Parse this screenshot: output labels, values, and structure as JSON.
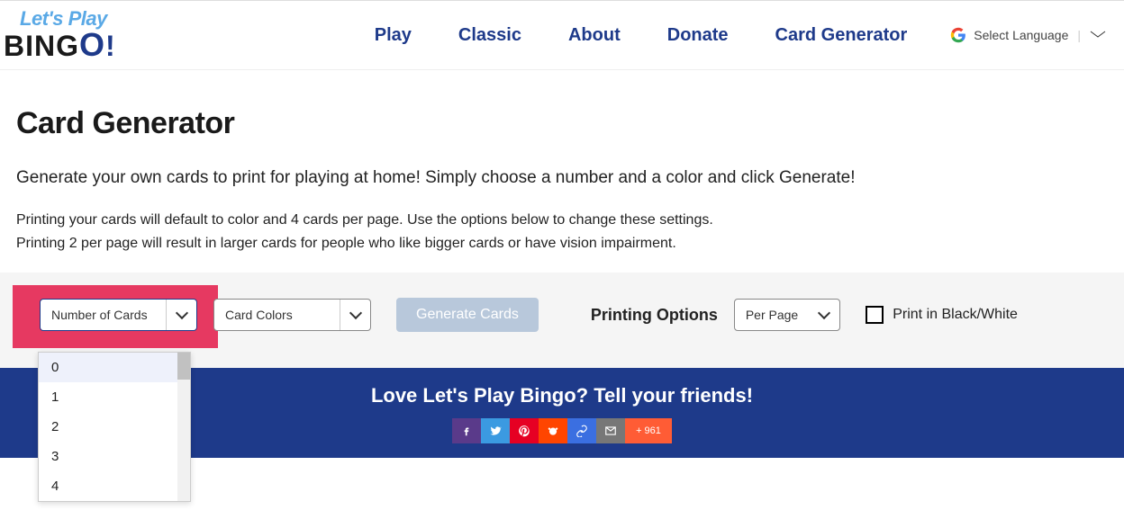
{
  "logo": {
    "top": "Let's Play",
    "bottom": "BING",
    "o": "O",
    "ex": "!"
  },
  "nav": {
    "play": "Play",
    "classic": "Classic",
    "about": "About",
    "donate": "Donate",
    "generator": "Card Generator"
  },
  "lang": {
    "label": "Select Language"
  },
  "page": {
    "title": "Card Generator",
    "intro": "Generate your own cards to print for playing at home! Simply choose a number and a color and click Generate!",
    "note1": "Printing your cards will default to color and 4 cards per page. Use the options below to change these settings.",
    "note2": "Printing 2 per page will result in larger cards for people who like bigger cards or have vision impairment."
  },
  "form": {
    "number_label": "Number of Cards",
    "colors_label": "Card Colors",
    "generate_label": "Generate Cards",
    "printing_options": "Printing Options",
    "per_page_label": "Per Page",
    "bw_label": "Print in Black/White",
    "number_options": [
      "0",
      "1",
      "2",
      "3",
      "4"
    ]
  },
  "footer": {
    "heading": "Love Let's Play Bingo? Tell your friends!",
    "share_count": "961"
  }
}
